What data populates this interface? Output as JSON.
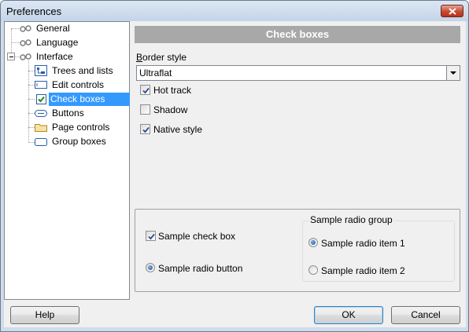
{
  "window": {
    "title": "Preferences"
  },
  "tree": {
    "items": [
      {
        "label": "General",
        "level": 0
      },
      {
        "label": "Language",
        "level": 0
      },
      {
        "label": "Interface",
        "level": 0,
        "expanded": true
      },
      {
        "label": "Trees and lists",
        "level": 1
      },
      {
        "label": "Edit controls",
        "level": 1
      },
      {
        "label": "Check boxes",
        "level": 1,
        "selected": true
      },
      {
        "label": "Buttons",
        "level": 1
      },
      {
        "label": "Page controls",
        "level": 1
      },
      {
        "label": "Group boxes",
        "level": 1
      }
    ]
  },
  "panel": {
    "header": "Check boxes",
    "border_style_label": "Border style",
    "border_style_value": "Ultraflat",
    "options": [
      {
        "label": "Hot track",
        "checked": true
      },
      {
        "label": "Shadow",
        "checked": false
      },
      {
        "label": "Native style",
        "checked": true
      }
    ]
  },
  "preview": {
    "sample_check_box": {
      "label": "Sample check box",
      "checked": true
    },
    "sample_radio_button": {
      "label": "Sample radio button",
      "checked": true
    },
    "radio_group": {
      "caption": "Sample radio group",
      "items": [
        {
          "label": "Sample radio item 1",
          "checked": true
        },
        {
          "label": "Sample radio item 2",
          "checked": false
        }
      ]
    }
  },
  "buttons": {
    "help": "Help",
    "ok": "OK",
    "cancel": "Cancel"
  },
  "colors": {
    "selection": "#3399ff",
    "header_bar": "#a8a8a8",
    "title_bar": "#c4d4e8"
  }
}
